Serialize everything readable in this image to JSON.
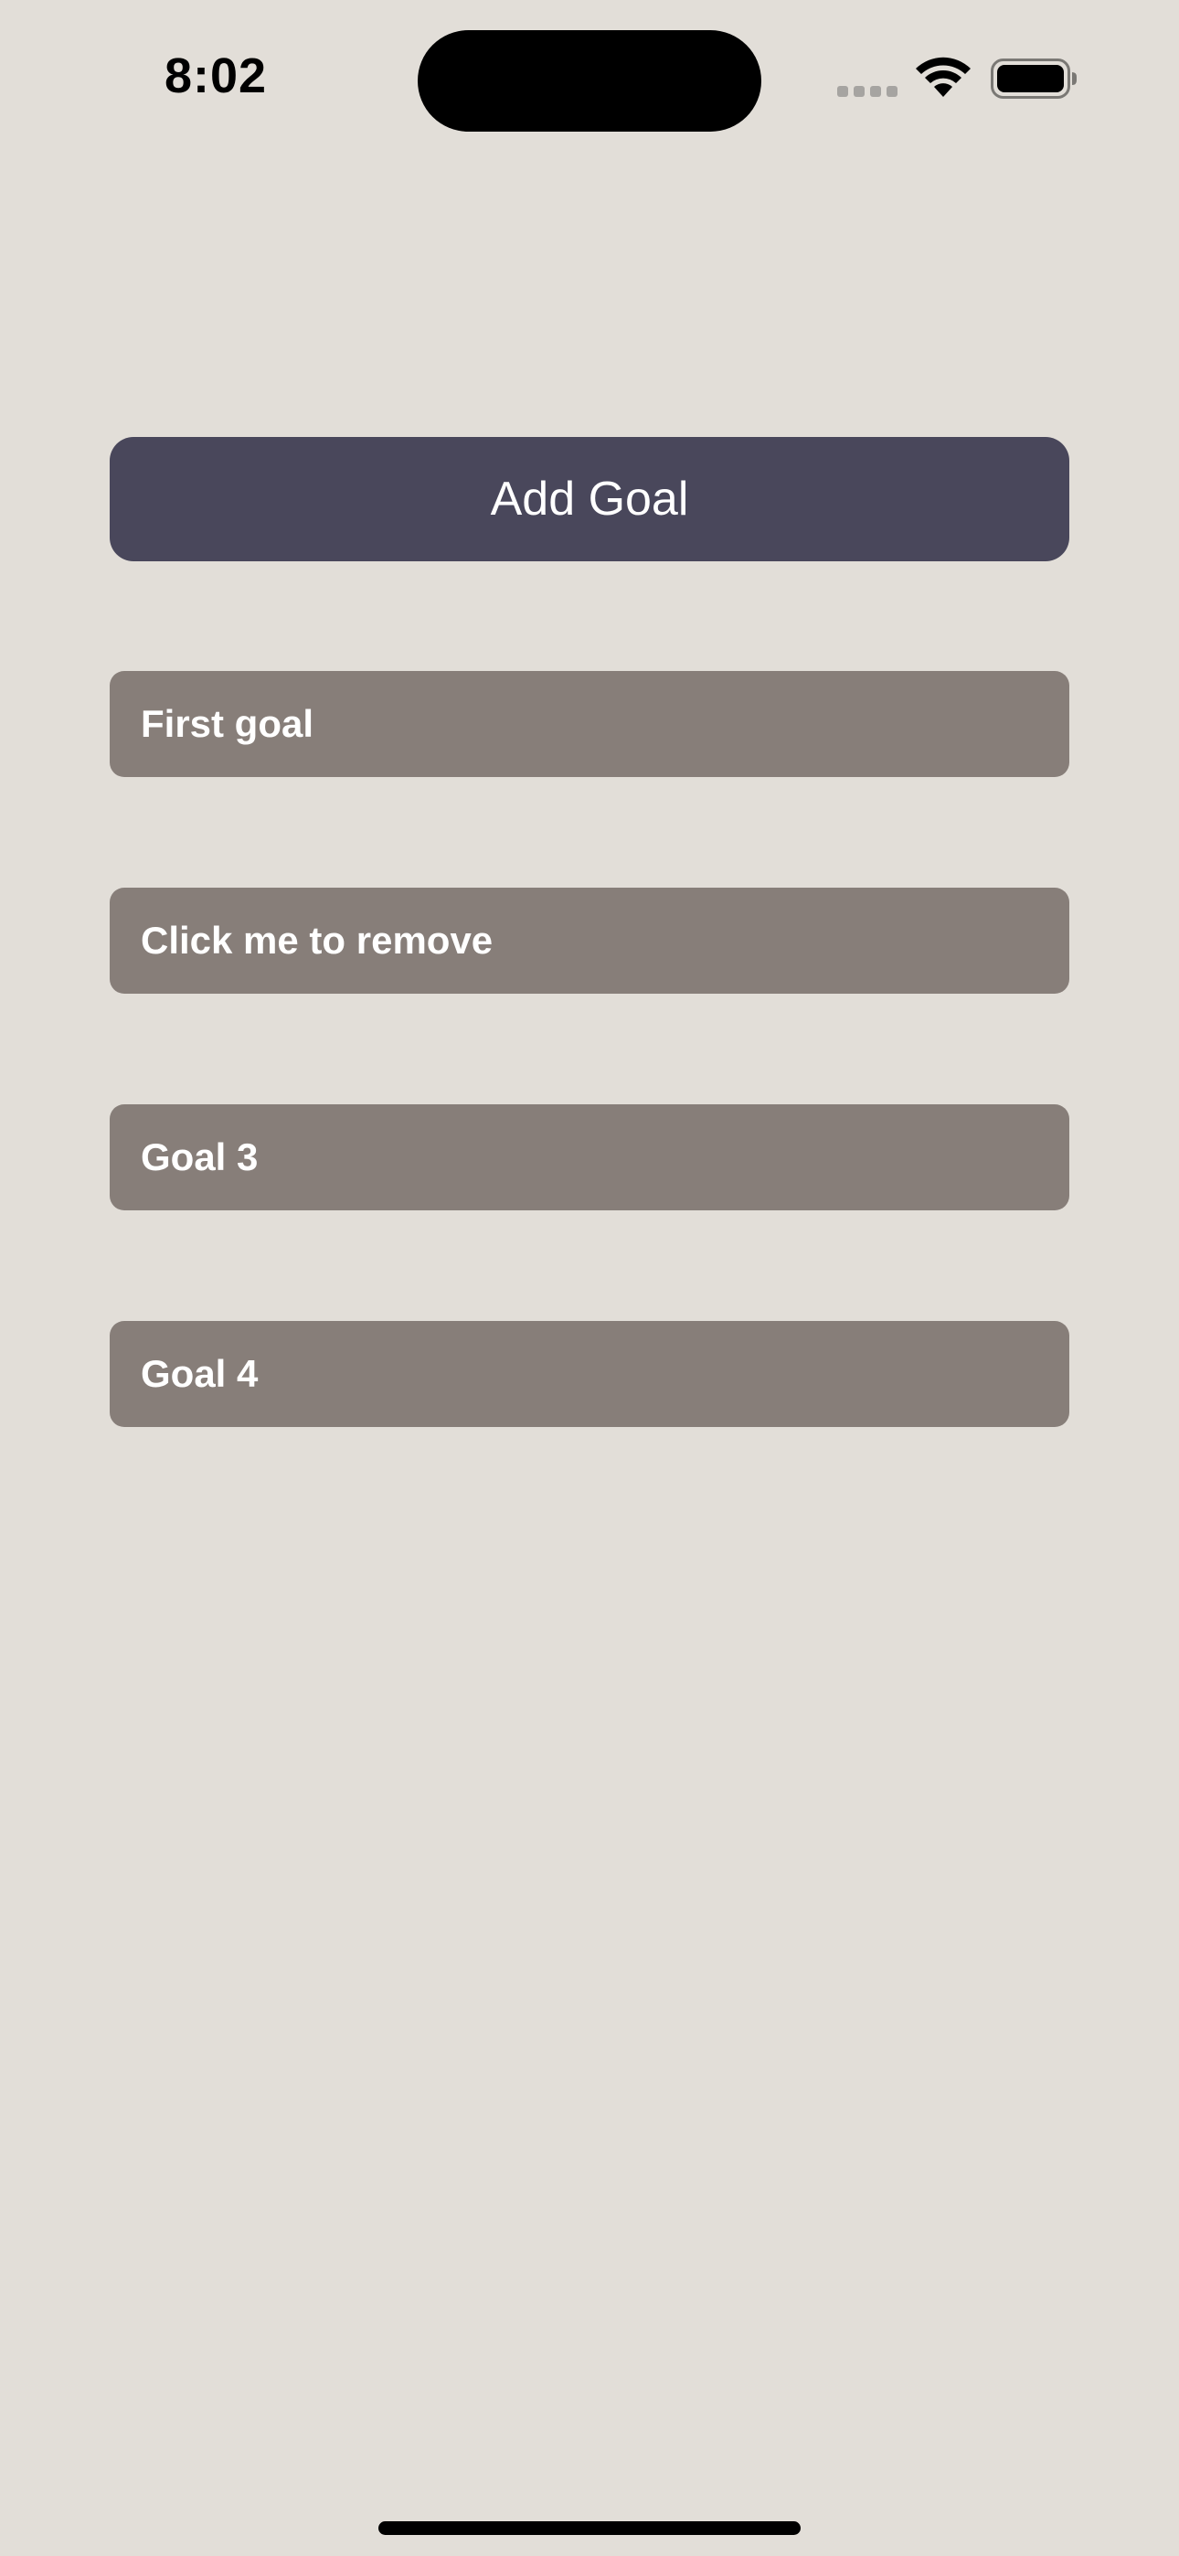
{
  "status_bar": {
    "time": "8:02",
    "icons": [
      "cellular-signal-icon",
      "wifi-icon",
      "battery-icon"
    ]
  },
  "add_goal_button": {
    "label": "Add Goal"
  },
  "goals": [
    {
      "label": "First goal"
    },
    {
      "label": "Click me to remove"
    },
    {
      "label": "Goal 3"
    },
    {
      "label": "Goal 4"
    }
  ],
  "colors": {
    "background": "#e2ded8",
    "button": "#49475b",
    "goal_item": "#877e79",
    "text_on_dark": "#ffffff"
  }
}
